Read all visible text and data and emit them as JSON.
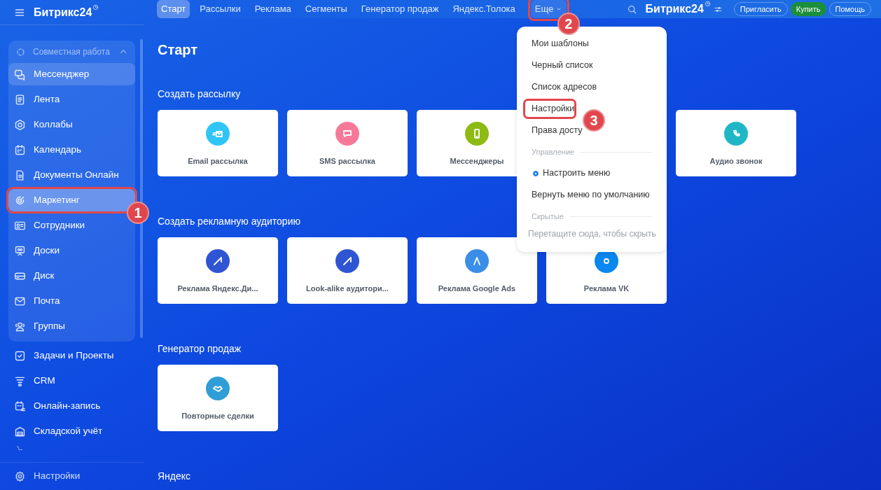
{
  "app": {
    "logo": "Битрикс24"
  },
  "sidebar": {
    "group": {
      "title": "Совместная работа",
      "expanded": true,
      "items": [
        {
          "label": "Мессенджер",
          "selected": false,
          "hovered": true
        },
        {
          "label": "Лента",
          "selected": false,
          "hovered": false
        },
        {
          "label": "Коллабы",
          "selected": false,
          "hovered": false
        },
        {
          "label": "Календарь",
          "selected": false,
          "hovered": false
        },
        {
          "label": "Документы Онлайн",
          "selected": false,
          "hovered": false
        },
        {
          "label": "Маркетинг",
          "selected": true,
          "hovered": false,
          "callout": "1"
        },
        {
          "label": "Сотрудники",
          "selected": false,
          "hovered": false
        },
        {
          "label": "Доски",
          "selected": false,
          "hovered": false
        },
        {
          "label": "Диск",
          "selected": false,
          "hovered": false
        },
        {
          "label": "Почта",
          "selected": false,
          "hovered": false
        },
        {
          "label": "Группы",
          "selected": false,
          "hovered": false
        }
      ]
    },
    "items": [
      {
        "label": "Задачи и Проекты"
      },
      {
        "label": "CRM"
      },
      {
        "label": "Онлайн-запись"
      },
      {
        "label": "Складской учёт"
      }
    ],
    "footer": {
      "label": "Настройки"
    }
  },
  "tabs": [
    {
      "label": "Старт",
      "selected": true
    },
    {
      "label": "Рассылки",
      "selected": false
    },
    {
      "label": "Реклама",
      "selected": false
    },
    {
      "label": "Сегменты",
      "selected": false
    },
    {
      "label": "Генератор продаж",
      "selected": false
    },
    {
      "label": "Яндекс.Толока",
      "selected": false
    },
    {
      "label": "Еще",
      "selected": false,
      "callout": "2",
      "kind": "more"
    }
  ],
  "header_right": {
    "logo": "Битрикс24",
    "buttons": [
      {
        "label": "Пригласить",
        "kind": "outline"
      },
      {
        "label": "Купить",
        "kind": "primary"
      },
      {
        "label": "Помощь",
        "kind": "outline"
      }
    ]
  },
  "page_title": "Старт",
  "sections": [
    {
      "title": "Создать рассылку",
      "cards": [
        {
          "label": "Email рассылка",
          "color": "#2fc6f6"
        },
        {
          "label": "SMS рассылка",
          "color": "#f7799a"
        },
        {
          "label": "Мессенджеры",
          "color": "#8dbb14"
        },
        {
          "label": "Аудио звонок",
          "color": "#1fb7c6",
          "after_gap": true
        }
      ]
    },
    {
      "title": "Создать рекламную аудиторию",
      "cards": [
        {
          "label": "Реклама Яндекс.Ди...",
          "color": "#2f55d4"
        },
        {
          "label": "Look-alike аудитори...",
          "color": "#2f55d4"
        },
        {
          "label": "Реклама Google Ads",
          "color": "#3b8ee8"
        },
        {
          "label": "Реклама VK",
          "color": "#0a87f0"
        }
      ]
    },
    {
      "title": "Генератор продаж",
      "cards": [
        {
          "label": "Повторные сделки",
          "color": "#2f9ed6"
        }
      ]
    },
    {
      "title": "Яндекс"
    }
  ],
  "menu": {
    "items": [
      {
        "kind": "item",
        "label": "Мои шаблоны"
      },
      {
        "kind": "item",
        "label": "Черный список"
      },
      {
        "kind": "item",
        "label": "Список адресов"
      },
      {
        "kind": "item",
        "label": "Настройки",
        "callout": "3"
      },
      {
        "kind": "item",
        "label": "Права досту"
      },
      {
        "kind": "section",
        "label": "Управление"
      },
      {
        "kind": "action",
        "label": "Настроить меню"
      },
      {
        "kind": "item",
        "label": "Вернуть меню по умолчанию"
      },
      {
        "kind": "section",
        "label": "Скрытые"
      },
      {
        "kind": "hint",
        "label": "Перетащите сюда, чтобы скрыть"
      }
    ]
  }
}
